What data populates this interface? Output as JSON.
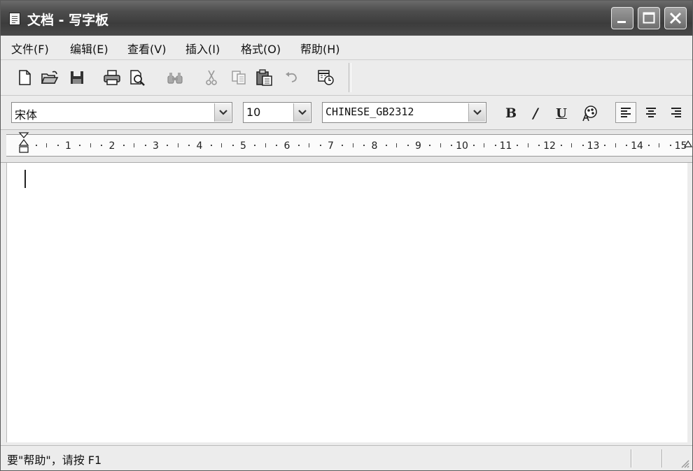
{
  "window": {
    "title": "文档 - 写字板"
  },
  "menu": [
    {
      "label": "文件(F)"
    },
    {
      "label": "编辑(E)"
    },
    {
      "label": "查看(V)"
    },
    {
      "label": "插入(I)"
    },
    {
      "label": "格式(O)"
    },
    {
      "label": "帮助(H)"
    }
  ],
  "toolbar": {
    "icons": [
      "new-document-icon",
      "open-folder-icon",
      "save-icon",
      "print-icon",
      "print-preview-icon",
      "find-icon",
      "cut-icon",
      "copy-icon",
      "paste-icon",
      "undo-icon",
      "insert-date-time-icon"
    ]
  },
  "format": {
    "font": "宋体",
    "size": "10",
    "script": "CHINESE_GB2312",
    "bold_label": "B",
    "italic_label": "/",
    "underline_label": "U"
  },
  "ruler": {
    "labels": [
      "1",
      "2",
      "3",
      "4",
      "5",
      "6",
      "7",
      "8",
      "9",
      "10",
      "11",
      "12",
      "13",
      "14",
      "15"
    ]
  },
  "document": {
    "text": ""
  },
  "status": {
    "text": "要\"帮助\"，请按 F1"
  }
}
